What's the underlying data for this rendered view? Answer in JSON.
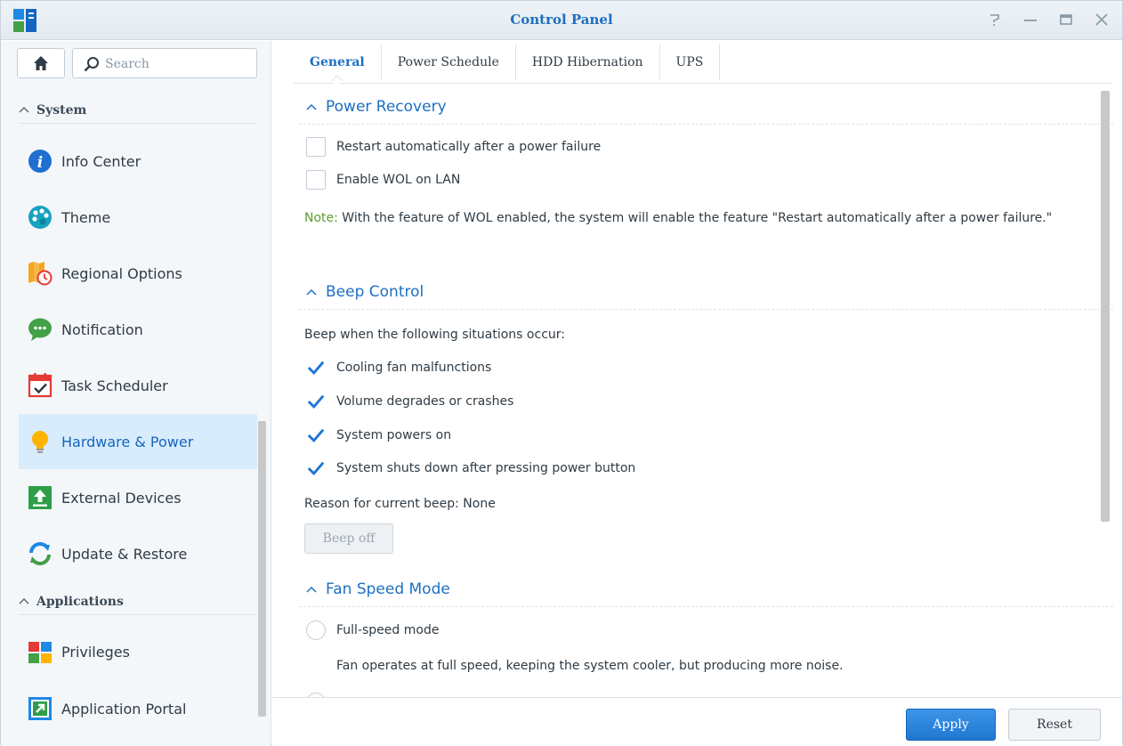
{
  "window": {
    "title": "Control Panel",
    "controls": [
      "help-icon",
      "minimize-icon",
      "maximize-icon",
      "close-icon"
    ]
  },
  "sidebar": {
    "search_placeholder": "Search",
    "sections": [
      {
        "title": "System",
        "items": [
          {
            "label": "Info Center",
            "icon": "info-icon"
          },
          {
            "label": "Theme",
            "icon": "palette-icon"
          },
          {
            "label": "Regional Options",
            "icon": "regional-options-icon"
          },
          {
            "label": "Notification",
            "icon": "chat-bubble-icon"
          },
          {
            "label": "Task Scheduler",
            "icon": "calendar-check-icon"
          },
          {
            "label": "Hardware & Power",
            "icon": "lightbulb-icon",
            "active": true
          },
          {
            "label": "External Devices",
            "icon": "upload-icon"
          },
          {
            "label": "Update & Restore",
            "icon": "refresh-icon"
          }
        ]
      },
      {
        "title": "Applications",
        "items": [
          {
            "label": "Privileges",
            "icon": "privileges-icon"
          },
          {
            "label": "Application Portal",
            "icon": "portal-arrow-icon"
          }
        ]
      }
    ]
  },
  "tabs": [
    {
      "label": "General",
      "active": true
    },
    {
      "label": "Power Schedule"
    },
    {
      "label": "HDD Hibernation"
    },
    {
      "label": "UPS"
    }
  ],
  "power_recovery": {
    "title": "Power Recovery",
    "options": [
      {
        "label": "Restart automatically after a power failure",
        "checked": false
      },
      {
        "label": "Enable WOL on LAN",
        "checked": false
      }
    ],
    "note_label": "Note:",
    "note_text": " With the feature of WOL enabled, the system will enable the feature \"Restart automatically after a power failure.\""
  },
  "beep_control": {
    "title": "Beep Control",
    "intro": "Beep when the following situations occur:",
    "options": [
      {
        "label": "Cooling fan malfunctions",
        "checked": true
      },
      {
        "label": "Volume degrades or crashes",
        "checked": true
      },
      {
        "label": "System powers on",
        "checked": true
      },
      {
        "label": "System shuts down after pressing power button",
        "checked": true
      }
    ],
    "reason": "Reason for current beep: None",
    "beep_off_label": "Beep off"
  },
  "fan_speed": {
    "title": "Fan Speed Mode",
    "options": [
      {
        "label": "Full-speed mode",
        "description": "Fan operates at full speed, keeping the system cooler, but producing more noise."
      }
    ]
  },
  "footer": {
    "apply_label": "Apply",
    "reset_label": "Reset"
  },
  "colors": {
    "accent": "#1d6fc2",
    "active_bg": "#d9ecfb",
    "note": "#5aa02c"
  }
}
